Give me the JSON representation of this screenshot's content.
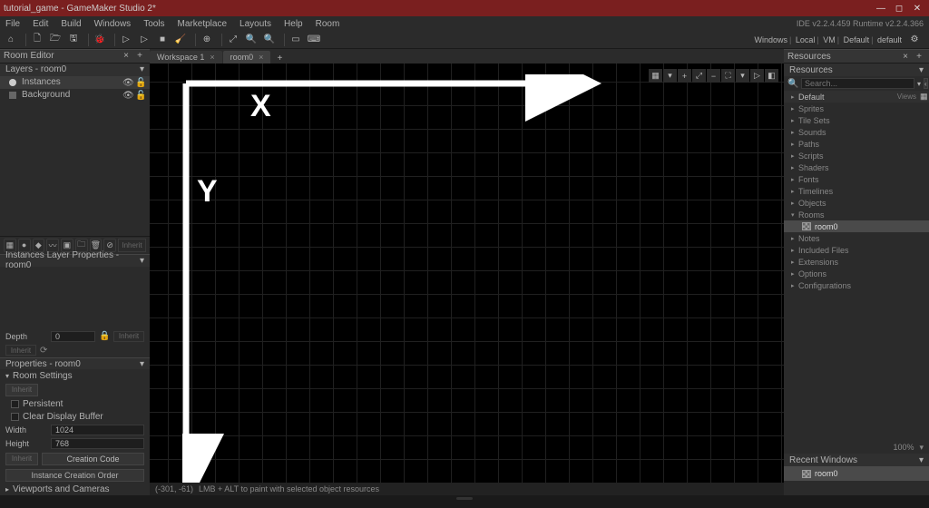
{
  "title": "tutorial_game - GameMaker Studio 2*",
  "menu": [
    "File",
    "Edit",
    "Build",
    "Windows",
    "Tools",
    "Marketplace",
    "Layouts",
    "Help",
    "Room"
  ],
  "ide_version": "IDE v2.2.4.459  Runtime v2.2.4.366",
  "config_crumbs": [
    "Windows",
    "Local",
    "VM",
    "Default",
    "default"
  ],
  "left": {
    "panel_title": "Room Editor",
    "layers_head": "Layers - room0",
    "layers": [
      {
        "name": "Instances",
        "selected": true
      },
      {
        "name": "Background",
        "selected": false
      }
    ],
    "inherit_btn": "Inherit",
    "instance_props_head": "Instances Layer Properties - room0",
    "depth_label": "Depth",
    "depth_value": "0",
    "props_head": "Properties - room0",
    "room_settings": "Room Settings",
    "persistent": "Persistent",
    "clear_buffer": "Clear Display Buffer",
    "width_label": "Width",
    "width_value": "1024",
    "height_label": "Height",
    "height_value": "768",
    "creation_code": "Creation Code",
    "instance_creation_order": "Instance Creation Order",
    "viewports": "Viewports and Cameras"
  },
  "center": {
    "tab1": "Workspace 1",
    "tab2": "room0",
    "status_coords": "(-301, -61)",
    "status_hint": "LMB + ALT to paint with selected object resources"
  },
  "right": {
    "panel_title": "Resources",
    "resources_head": "Resources",
    "search_placeholder": "Search...",
    "default_label": "Default",
    "views_label": "Views",
    "tree": [
      "Sprites",
      "Tile Sets",
      "Sounds",
      "Paths",
      "Scripts",
      "Shaders",
      "Fonts",
      "Timelines",
      "Objects"
    ],
    "rooms_label": "Rooms",
    "room_item": "room0",
    "tree2": [
      "Notes",
      "Included Files",
      "Extensions",
      "Options",
      "Configurations"
    ],
    "zoom": "100%",
    "recent_head": "Recent Windows",
    "recent_item": "room0"
  }
}
